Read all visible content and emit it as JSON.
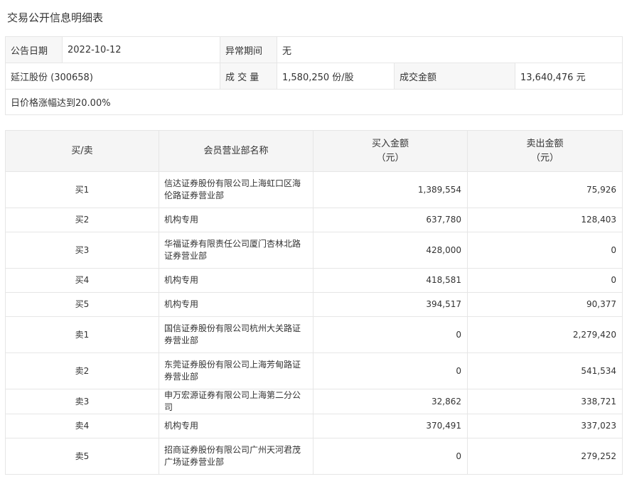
{
  "title": "交易公开信息明细表",
  "info": {
    "date_label": "公告日期",
    "date_value": "2022-10-12",
    "period_label": "异常期间",
    "period_value": "无",
    "stock": "延江股份 (300658)",
    "volume_label": "成 交 量",
    "volume_value": "1,580,250 份/股",
    "amount_label": "成交金额",
    "amount_value": "13,640,476 元",
    "reason": "日价格涨幅达到20.00%"
  },
  "table": {
    "headers": [
      "买/卖",
      "会员营业部名称",
      "买入金额\n（元）",
      "卖出金额\n（元）"
    ],
    "rows": [
      {
        "side": "买1",
        "name": "信达证券股份有限公司上海虹口区海伦路证券营业部",
        "buy": "1,389,554",
        "sell": "75,926"
      },
      {
        "side": "买2",
        "name": "机构专用",
        "buy": "637,780",
        "sell": "128,403"
      },
      {
        "side": "买3",
        "name": "华福证券有限责任公司厦门杏林北路证券营业部",
        "buy": "428,000",
        "sell": "0"
      },
      {
        "side": "买4",
        "name": "机构专用",
        "buy": "418,581",
        "sell": "0"
      },
      {
        "side": "买5",
        "name": "机构专用",
        "buy": "394,517",
        "sell": "90,377"
      },
      {
        "side": "卖1",
        "name": "国信证券股份有限公司杭州大关路证券营业部",
        "buy": "0",
        "sell": "2,279,420"
      },
      {
        "side": "卖2",
        "name": "东莞证券股份有限公司上海芳甸路证券营业部",
        "buy": "0",
        "sell": "541,534"
      },
      {
        "side": "卖3",
        "name": "申万宏源证券有限公司上海第二分公司",
        "buy": "32,862",
        "sell": "338,721"
      },
      {
        "side": "卖4",
        "name": "机构专用",
        "buy": "370,491",
        "sell": "337,023"
      },
      {
        "side": "卖5",
        "name": "招商证券股份有限公司广州天河君茂广场证券营业部",
        "buy": "0",
        "sell": "279,252"
      }
    ]
  }
}
